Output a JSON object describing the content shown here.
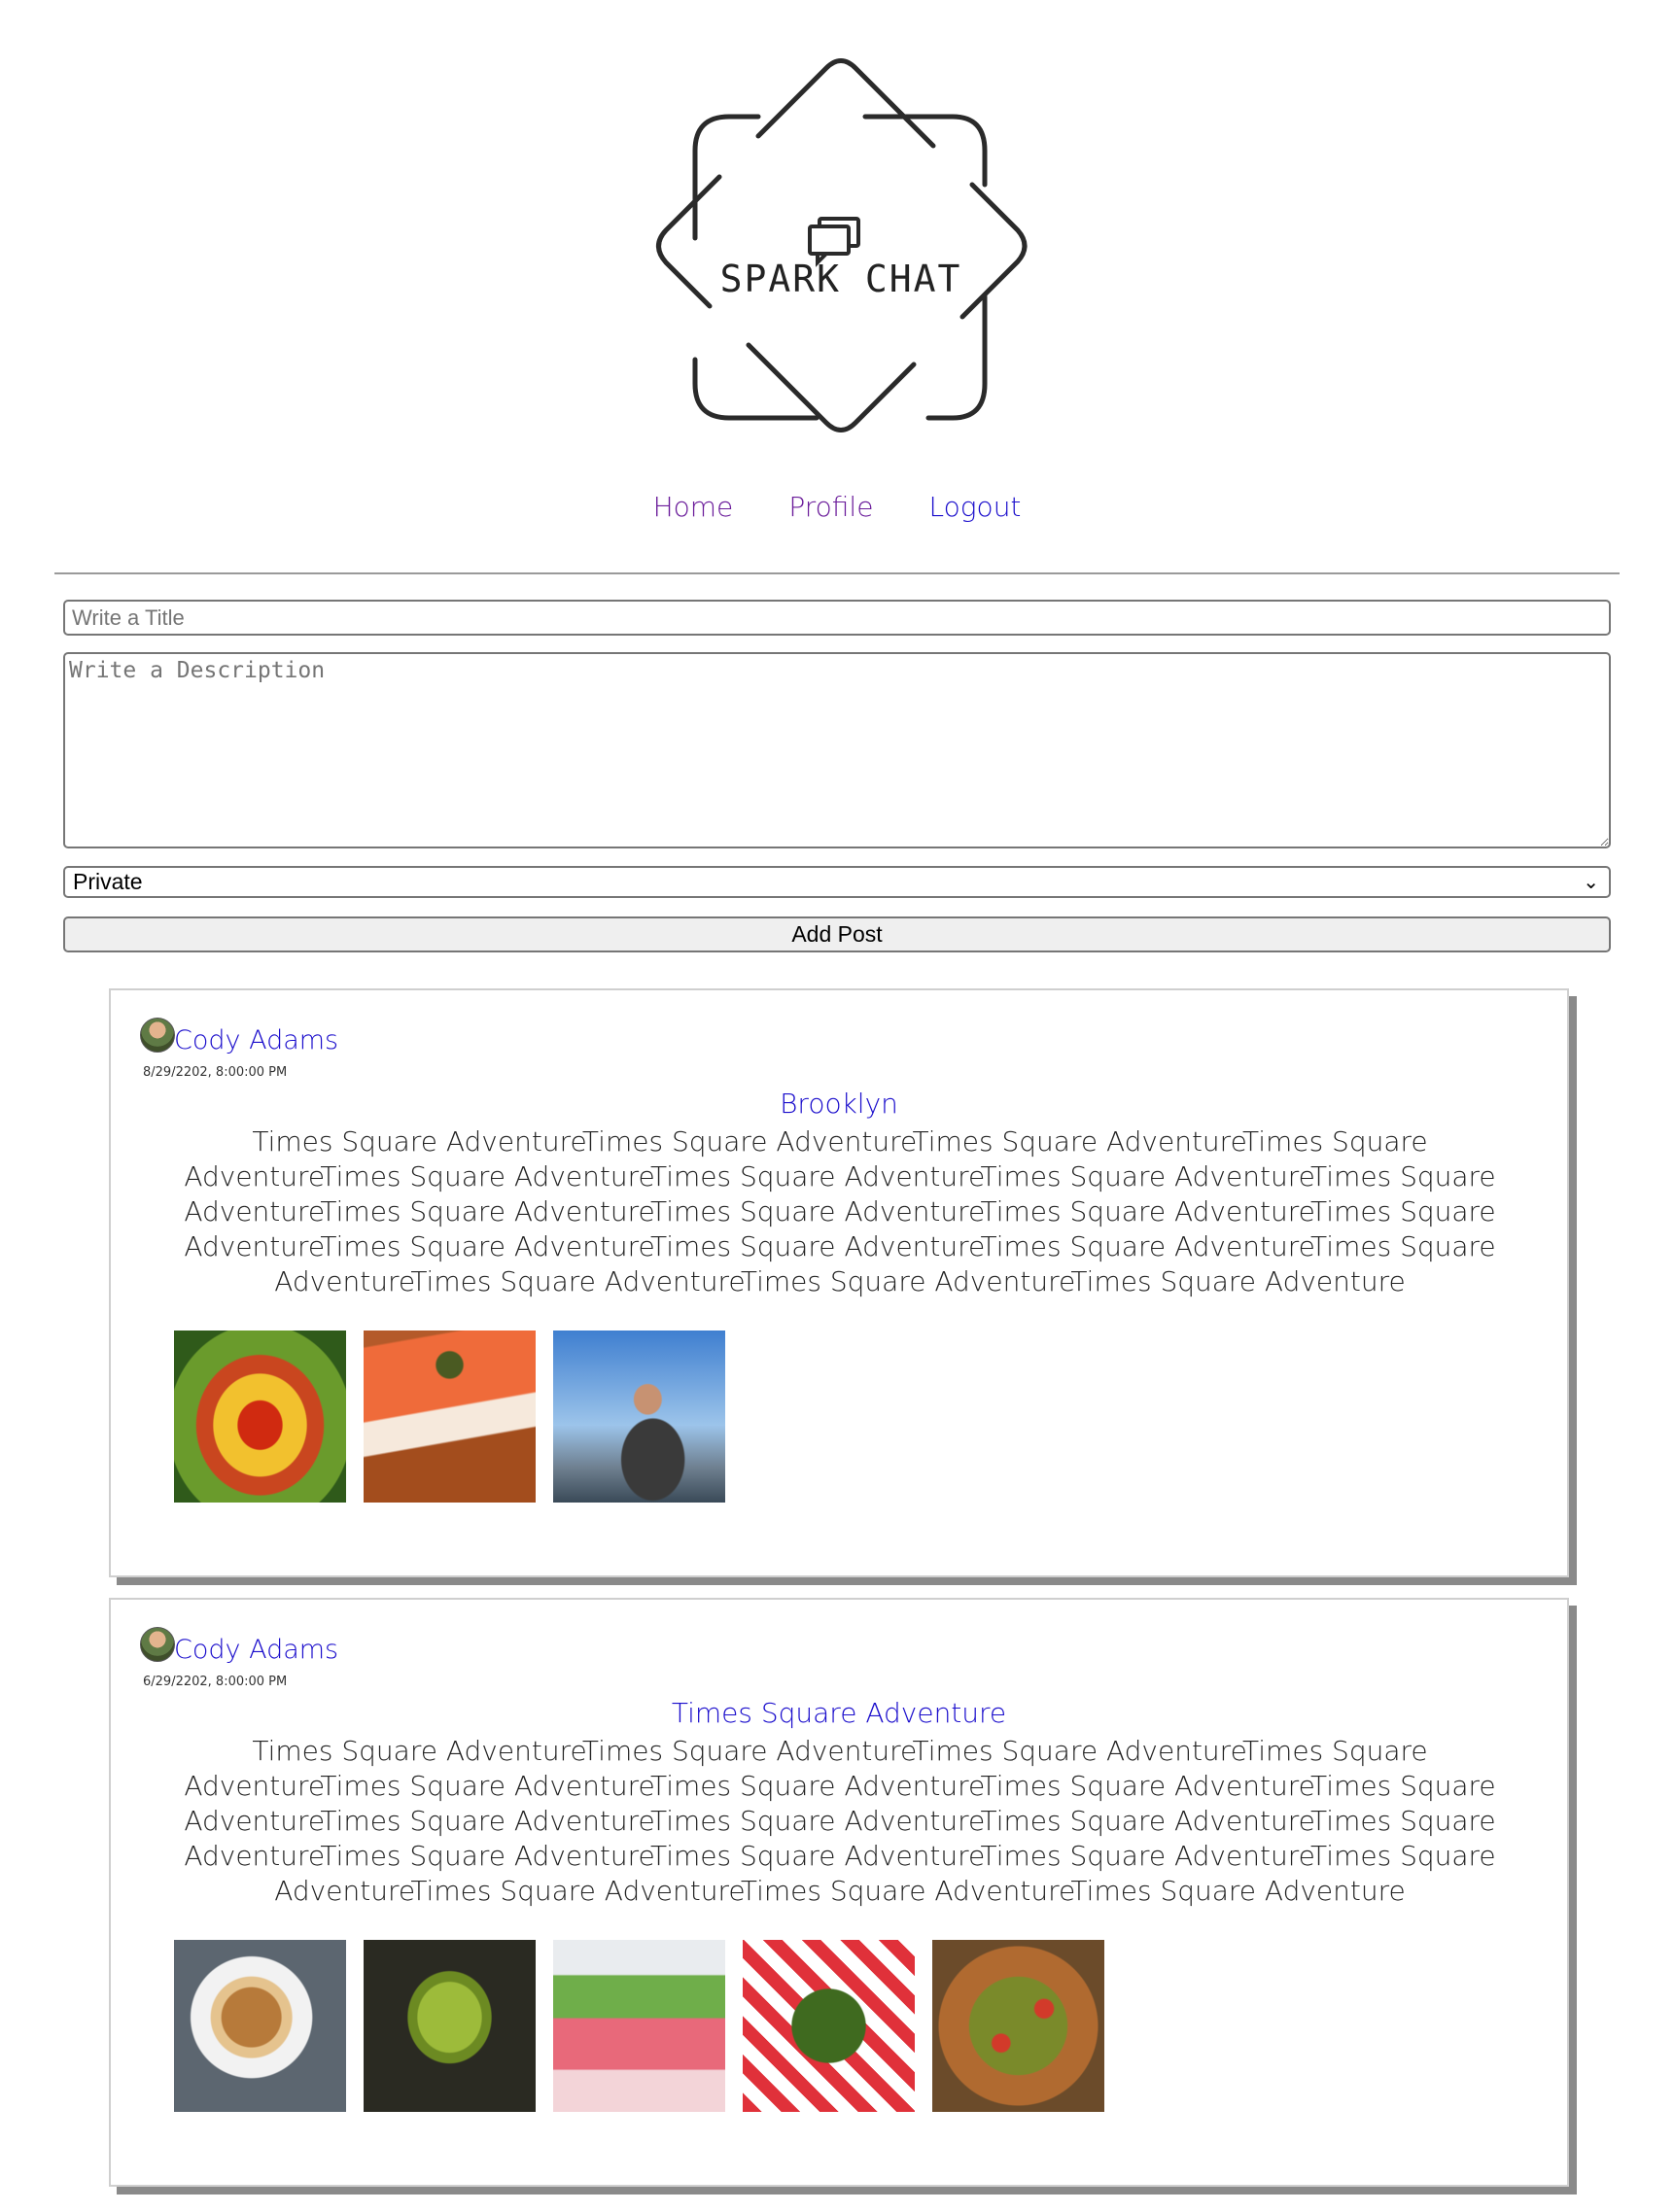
{
  "brand": {
    "name": "SPARK CHAT"
  },
  "nav": {
    "home": "Home",
    "profile": "Profile",
    "logout": "Logout"
  },
  "form": {
    "title_placeholder": "Write a Title",
    "description_placeholder": "Write a Description",
    "visibility_selected": "Private",
    "submit_label": "Add Post"
  },
  "posts": [
    {
      "author": "Cody Adams",
      "date": "8/29/2202, 8:00:00 PM",
      "title": "Brooklyn",
      "body": "Times Square AdventureTimes Square AdventureTimes Square AdventureTimes Square AdventureTimes Square AdventureTimes Square AdventureTimes Square AdventureTimes Square AdventureTimes Square AdventureTimes Square AdventureTimes Square AdventureTimes Square AdventureTimes Square AdventureTimes Square AdventureTimes Square AdventureTimes Square AdventureTimes Square AdventureTimes Square AdventureTimes Square Adventure",
      "images": [
        "flower-photo",
        "salmon-toast-photo",
        "person-portrait-photo"
      ]
    },
    {
      "author": "Cody Adams",
      "date": "6/29/2202, 8:00:00 PM",
      "title": "Times Square Adventure",
      "body": "Times Square AdventureTimes Square AdventureTimes Square AdventureTimes Square AdventureTimes Square AdventureTimes Square AdventureTimes Square AdventureTimes Square AdventureTimes Square AdventureTimes Square AdventureTimes Square AdventureTimes Square AdventureTimes Square AdventureTimes Square AdventureTimes Square AdventureTimes Square AdventureTimes Square AdventureTimes Square AdventureTimes Square Adventure",
      "images": [
        "mooncake-photo",
        "green-icecream-photo",
        "layered-cake-photo",
        "green-beans-photo",
        "pizza-photo"
      ]
    }
  ],
  "colors": {
    "link_visited": "#6a1b9a",
    "link": "#1a0dcc",
    "card_shadow": "#8a8a8a"
  }
}
